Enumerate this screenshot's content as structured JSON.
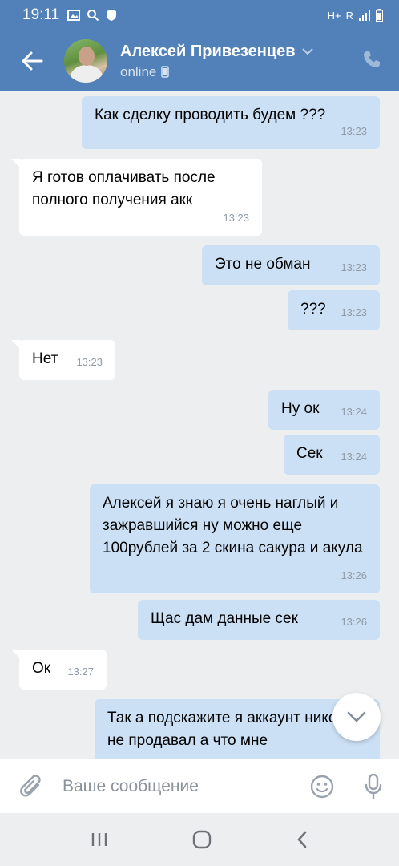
{
  "status_bar": {
    "time": "19:11",
    "network": "H+",
    "roaming": "R"
  },
  "header": {
    "name": "Алексей Привезенцев",
    "status": "online"
  },
  "messages": [
    {
      "dir": "out",
      "text": "Как сделку проводить будем ???",
      "time": "13:23"
    },
    {
      "dir": "in",
      "text": "Я готов оплачивать после полного получения акк",
      "time": "13:23"
    },
    {
      "dir": "out",
      "text": "Это не обман",
      "time": "13:23"
    },
    {
      "dir": "out",
      "text": "???",
      "time": "13:23"
    },
    {
      "dir": "in",
      "text": "Нет",
      "time": "13:23"
    },
    {
      "dir": "out",
      "text": "Ну ок",
      "time": "13:24"
    },
    {
      "dir": "out",
      "text": "Сек",
      "time": "13:24"
    },
    {
      "dir": "out",
      "text": "Алексей я знаю я очень наглый и зажравшийся ну можно еще 100рублей за 2 скина сакура и акула",
      "time": "13:26"
    },
    {
      "dir": "out",
      "text": "Щас дам данные сек",
      "time": "13:26"
    },
    {
      "dir": "in",
      "text": "Ок",
      "time": "13:27"
    },
    {
      "dir": "out",
      "text": "Так а подскажите я аккаунт никогда не продавал а что мне",
      "time": ""
    }
  ],
  "composer": {
    "placeholder": "Ваше сообщение"
  },
  "icons": {
    "back": "arrow-left-icon",
    "call": "phone-icon",
    "attach": "paperclip-icon",
    "emoji": "smile-icon",
    "mic": "microphone-icon",
    "scroll": "chevron-down-icon"
  },
  "colors": {
    "header": "#5181b8",
    "bubble_out": "#cce0f5",
    "bubble_in": "#ffffff",
    "background": "#edeef0"
  }
}
